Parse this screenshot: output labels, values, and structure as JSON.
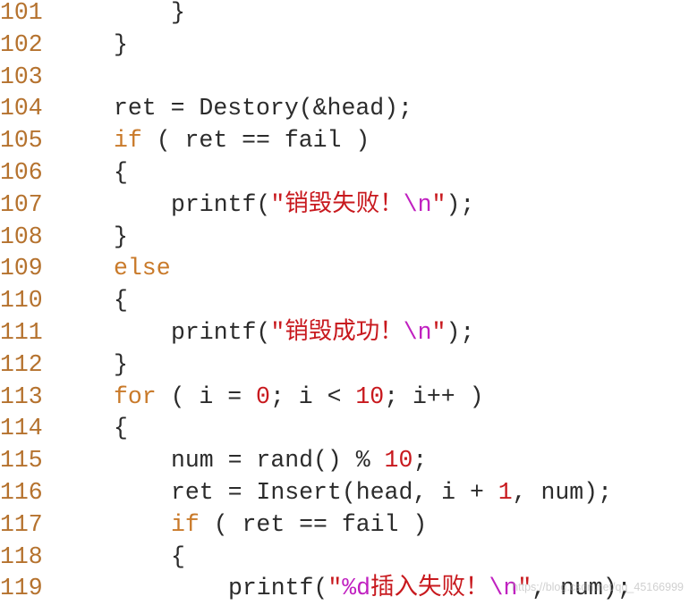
{
  "colors": {
    "line_number": "#b5722e",
    "keyword": "#c97a2a",
    "string": "#c8191e",
    "escape": "#c020c0",
    "number": "#c8191e",
    "text": "#2b2b2b"
  },
  "watermark": "https://blog.csdn.net/qq_45166999",
  "lines": [
    {
      "num": "101",
      "indent": 1,
      "tokens": [
        {
          "t": "}",
          "c": "plain"
        }
      ]
    },
    {
      "num": "102",
      "indent": 0,
      "tokens": [
        {
          "t": "}",
          "c": "plain"
        }
      ]
    },
    {
      "num": "103",
      "indent": 0,
      "tokens": []
    },
    {
      "num": "104",
      "indent": 0,
      "tokens": [
        {
          "t": "ret = Destory(&head);",
          "c": "plain"
        }
      ]
    },
    {
      "num": "105",
      "indent": 0,
      "tokens": [
        {
          "t": "if",
          "c": "kw"
        },
        {
          "t": " ( ret == fail )",
          "c": "plain"
        }
      ]
    },
    {
      "num": "106",
      "indent": 0,
      "tokens": [
        {
          "t": "{",
          "c": "plain"
        }
      ]
    },
    {
      "num": "107",
      "indent": 1,
      "tokens": [
        {
          "t": "printf(",
          "c": "plain"
        },
        {
          "t": "\"销毁失败！",
          "c": "str"
        },
        {
          "t": "\\n",
          "c": "esc"
        },
        {
          "t": "\"",
          "c": "str"
        },
        {
          "t": ");",
          "c": "plain"
        }
      ]
    },
    {
      "num": "108",
      "indent": 0,
      "tokens": [
        {
          "t": "}",
          "c": "plain"
        }
      ]
    },
    {
      "num": "109",
      "indent": 0,
      "tokens": [
        {
          "t": "else",
          "c": "kw"
        }
      ]
    },
    {
      "num": "110",
      "indent": 0,
      "tokens": [
        {
          "t": "{",
          "c": "plain"
        }
      ]
    },
    {
      "num": "111",
      "indent": 1,
      "tokens": [
        {
          "t": "printf(",
          "c": "plain"
        },
        {
          "t": "\"销毁成功！",
          "c": "str"
        },
        {
          "t": "\\n",
          "c": "esc"
        },
        {
          "t": "\"",
          "c": "str"
        },
        {
          "t": ");",
          "c": "plain"
        }
      ]
    },
    {
      "num": "112",
      "indent": 0,
      "tokens": [
        {
          "t": "}",
          "c": "plain"
        }
      ]
    },
    {
      "num": "113",
      "indent": 0,
      "tokens": [
        {
          "t": "for",
          "c": "kw"
        },
        {
          "t": " ( i = ",
          "c": "plain"
        },
        {
          "t": "0",
          "c": "num"
        },
        {
          "t": "; i < ",
          "c": "plain"
        },
        {
          "t": "10",
          "c": "num"
        },
        {
          "t": "; i++ )",
          "c": "plain"
        }
      ]
    },
    {
      "num": "114",
      "indent": 0,
      "tokens": [
        {
          "t": "{",
          "c": "plain"
        }
      ]
    },
    {
      "num": "115",
      "indent": 1,
      "tokens": [
        {
          "t": "num = rand() % ",
          "c": "plain"
        },
        {
          "t": "10",
          "c": "num"
        },
        {
          "t": ";",
          "c": "plain"
        }
      ]
    },
    {
      "num": "116",
      "indent": 1,
      "tokens": [
        {
          "t": "ret = Insert(head, i + ",
          "c": "plain"
        },
        {
          "t": "1",
          "c": "num"
        },
        {
          "t": ", num);",
          "c": "plain"
        }
      ]
    },
    {
      "num": "117",
      "indent": 1,
      "tokens": [
        {
          "t": "if",
          "c": "kw"
        },
        {
          "t": " ( ret == fail )",
          "c": "plain"
        }
      ]
    },
    {
      "num": "118",
      "indent": 1,
      "tokens": [
        {
          "t": "{",
          "c": "plain"
        }
      ]
    },
    {
      "num": "119",
      "indent": 2,
      "tokens": [
        {
          "t": "printf(",
          "c": "plain"
        },
        {
          "t": "\"",
          "c": "str"
        },
        {
          "t": "%d",
          "c": "esc"
        },
        {
          "t": "插入失败！",
          "c": "str"
        },
        {
          "t": "\\n",
          "c": "esc"
        },
        {
          "t": "\"",
          "c": "str"
        },
        {
          "t": ", num);",
          "c": "plain"
        }
      ]
    }
  ]
}
